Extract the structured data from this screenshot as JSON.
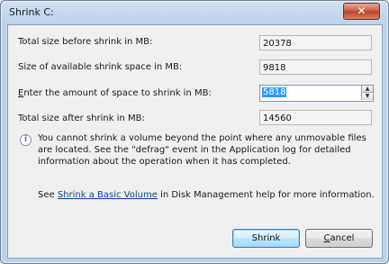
{
  "window": {
    "title": "Shrink C:",
    "close_label": "✕"
  },
  "fields": {
    "total_before_label": "Total size before shrink in MB:",
    "total_before_value": "20378",
    "available_label": "Size of available shrink space in MB:",
    "available_value": "9818",
    "amount_label_prefix": "E",
    "amount_label_rest": "nter the amount of space to shrink in MB:",
    "amount_value": "5818",
    "total_after_label": "Total size after shrink in MB:",
    "total_after_value": "14560"
  },
  "info": {
    "icon": "info-icon",
    "text": "You cannot shrink a volume beyond the point where any unmovable files are located. See the \"defrag\" event in the Application log for detailed information about the operation when it has completed."
  },
  "help": {
    "prefix": "See ",
    "link": "Shrink a Basic Volume",
    "suffix": " in Disk Management help for more information."
  },
  "buttons": {
    "shrink_label": "Shrink",
    "cancel_label_prefix": "C",
    "cancel_label_rest": "ancel"
  }
}
